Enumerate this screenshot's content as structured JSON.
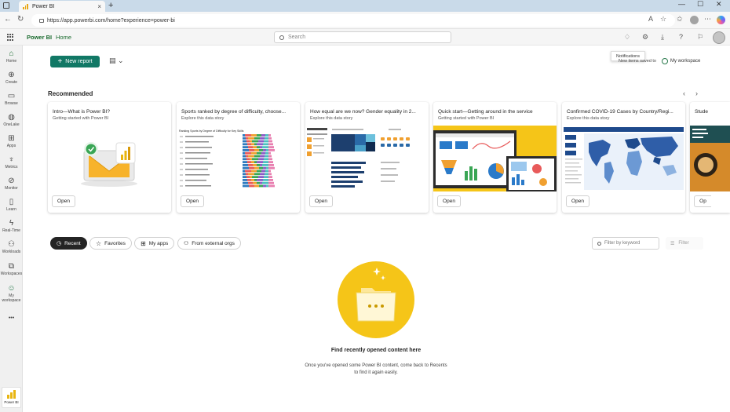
{
  "browser": {
    "tab_title": "Power BI",
    "tab_close": "×",
    "new_tab": "+",
    "url": "https://app.powerbi.com/home?experience=power-bi",
    "window_controls": [
      "—",
      "☐",
      "✕"
    ]
  },
  "header": {
    "brand": "Power BI",
    "breadcrumb": "Home",
    "search_placeholder": "Search"
  },
  "left_nav": [
    {
      "label": "Home",
      "icon": "home-icon",
      "glyph": "⌂"
    },
    {
      "label": "Create",
      "icon": "create-icon",
      "glyph": "⊕"
    },
    {
      "label": "Browse",
      "icon": "browse-icon",
      "glyph": "▭"
    },
    {
      "label": "OneLake",
      "icon": "onelake-icon",
      "glyph": "◍"
    },
    {
      "label": "Apps",
      "icon": "apps-icon",
      "glyph": "⊞"
    },
    {
      "label": "Metrics",
      "icon": "metrics-icon",
      "glyph": "♆"
    },
    {
      "label": "Monitor",
      "icon": "monitor-icon",
      "glyph": "⊘"
    },
    {
      "label": "Learn",
      "icon": "learn-icon",
      "glyph": "▯"
    },
    {
      "label": "Real-Time",
      "icon": "realtime-icon",
      "glyph": "ϟ"
    },
    {
      "label": "Workloads",
      "icon": "workloads-icon",
      "glyph": "⚇"
    },
    {
      "label": "Workspaces",
      "icon": "workspaces-icon",
      "glyph": "⧉"
    },
    {
      "label": "My workspace",
      "icon": "my-workspace-icon",
      "glyph": "☺"
    }
  ],
  "nav_more": "•••",
  "pbi_tile_label": "Power BI",
  "toolbar": {
    "new_report": "New report",
    "tooltip": "Notifications",
    "new_items_note": "New items saved to",
    "my_workspace": "My workspace"
  },
  "recommended": {
    "title": "Recommended",
    "cards": [
      {
        "title": "Intro—What is Power BI?",
        "subtitle": "Getting started with Power BI",
        "open": "Open"
      },
      {
        "title": "Sports ranked by degree of difficulty, choose...",
        "subtitle": "Explore this data story",
        "open": "Open"
      },
      {
        "title": "How equal are we now? Gender equality in 2...",
        "subtitle": "Explore this data story",
        "open": "Open"
      },
      {
        "title": "Quick start—Getting around in the service",
        "subtitle": "Getting started with Power BI",
        "open": "Open"
      },
      {
        "title": "Confirmed COVID-19 Cases by Country/Regi...",
        "subtitle": "Explore this data story",
        "open": "Open"
      },
      {
        "title": "Stude",
        "subtitle": "",
        "open": "Op"
      }
    ],
    "sports_chart_title": "Ranking Sports by Degree of Difficulty for Key Skills"
  },
  "filters": {
    "recent": "Recent",
    "favorites": "Favorites",
    "my_apps": "My apps",
    "external": "From external orgs",
    "keyword_placeholder": "Filter by keyword",
    "filter": "Filter"
  },
  "empty_state": {
    "title": "Find recently opened content here",
    "line1": "Once you've opened some Power BI content, come back to Recents",
    "line2": "to find it again easily."
  },
  "colors": {
    "accent": "#117865",
    "brand_yellow": "#f5c518",
    "chrome_blue": "#c9dae9"
  }
}
